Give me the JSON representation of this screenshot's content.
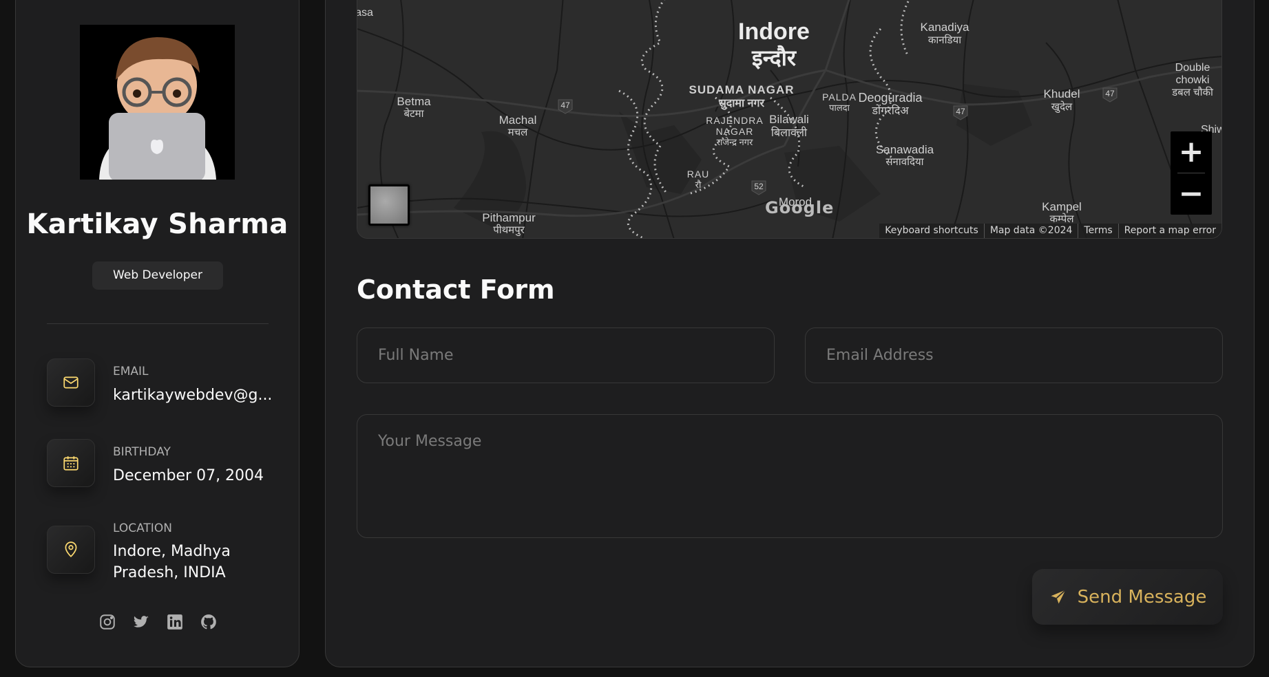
{
  "profile": {
    "name": "Kartikay Sharma",
    "role": "Web Developer"
  },
  "contacts": [
    {
      "title": "Email",
      "value": "kartikaywebdev@g...",
      "icon": "mail-icon"
    },
    {
      "title": "Birthday",
      "value": "December 07, 2004",
      "icon": "calendar-icon"
    },
    {
      "title": "Location",
      "value": "Indore, Madhya Pradesh, INDIA",
      "icon": "location-pin-icon"
    }
  ],
  "socials": [
    "instagram-icon",
    "twitter-icon",
    "linkedin-icon",
    "github-icon"
  ],
  "map": {
    "labels": {
      "indore_en": "Indore",
      "indore_hi": "इन्दौर",
      "sudama_en": "SUDAMA NAGAR",
      "sudama_hi": "सुदामा नगर",
      "rajendra_en1": "RAJENDRA",
      "rajendra_en2": "NAGAR",
      "rajendra_hi": "राजेन्द्र नगर",
      "bilawali_en": "Bilawali",
      "bilawali_hi": "बिलावली",
      "palda_en": "PALDA",
      "palda_hi": "पालदा",
      "deoguradia_en": "Deoguradia",
      "deoguradia_hi": "डोंगरदिअ",
      "kanadiya_en": "Kanadiya",
      "kanadiya_hi": "कानडिया",
      "khudel_en": "Khudel",
      "khudel_hi": "खुदेल",
      "double_en1": "Double",
      "double_en2": "chowki",
      "double_hi": "डबल चौकी",
      "betma_en": "Betma",
      "betma_hi": "बेटमा",
      "machal_en": "Machal",
      "machal_hi": "मचल",
      "sanawadia_en": "Sanawadia",
      "sanawadia_hi": "सनावदिया",
      "pithampur_en": "Pithampur",
      "pithampur_hi": "पीथमपुर",
      "kampel_en": "Kampel",
      "kampel_hi": "कम्पेल",
      "morod_en": "Morod",
      "rau_en": "RAU",
      "rau_hi": "रौ",
      "shiwr": "Shiwr",
      "asa": "asa",
      "hw47a": "47",
      "hw47b": "47",
      "hw47c": "47",
      "hw52": "52"
    },
    "google": "Google",
    "zoom_in": "+",
    "zoom_out": "−",
    "attrib": {
      "shortcuts": "Keyboard shortcuts",
      "data": "Map data ©2024",
      "terms": "Terms",
      "report": "Report a map error"
    }
  },
  "form": {
    "title": "Contact Form",
    "name_placeholder": "Full Name",
    "email_placeholder": "Email Address",
    "message_placeholder": "Your Message",
    "send_label": "Send Message"
  },
  "colors": {
    "accent": "#ffdb70",
    "panel": "#1e1e1f",
    "border": "#383838"
  }
}
